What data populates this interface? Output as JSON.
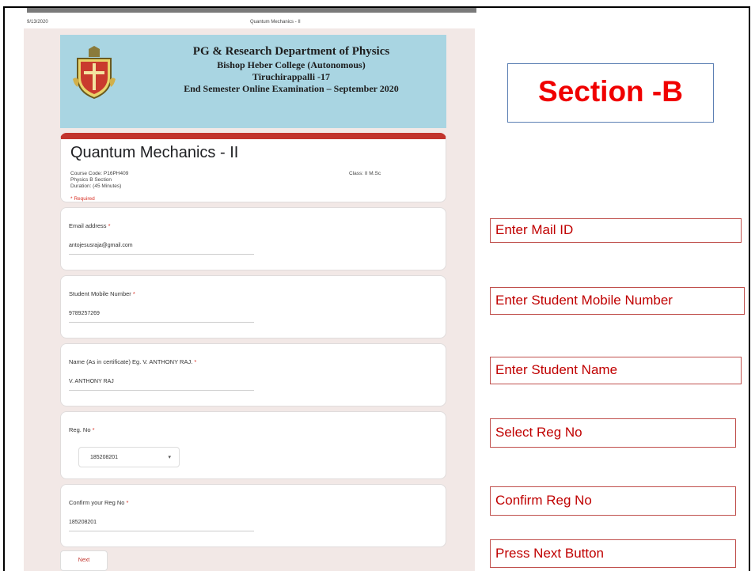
{
  "print_header": {
    "date": "9/13/2020",
    "title": "Quantum Mechanics - II"
  },
  "banner": {
    "line1": "PG & Research Department of Physics",
    "line2": "Bishop Heber College (Autonomous)",
    "line3": "Tiruchirappalli -17",
    "line4": "End Semester Online Examination – September 2020"
  },
  "form": {
    "title": "Quantum Mechanics - II",
    "course_code": "Course Code: P16PH409",
    "section": "Physics B Section",
    "duration": "Duration: (45 Minutes)",
    "class": "Class: II M.Sc",
    "required_note": "* Required"
  },
  "questions": {
    "email": {
      "label": "Email address",
      "star": " *",
      "value": "antojesusraja@gmail.com"
    },
    "mobile": {
      "label": "Student Mobile Number",
      "star": " *",
      "value": "9789257269"
    },
    "name": {
      "label": "Name (As in certificate) Eg. V. ANTHONY RAJ.",
      "star": " *",
      "value": "V. ANTHONY RAJ"
    },
    "reg": {
      "label": "Reg. No",
      "star": " *",
      "value": "185208201",
      "caret": "▾"
    },
    "confirm": {
      "label": "Confirm your Reg No",
      "star": " *",
      "value": "185208201"
    }
  },
  "next_button": "Next",
  "annotations": {
    "section": "Section -B",
    "mail": "Enter Mail ID",
    "mobile": "Enter Student Mobile Number",
    "name": "Enter Student Name",
    "reg": "Select  Reg No",
    "confirm": "Confirm Reg No",
    "next": "Press Next Button"
  },
  "colors": {
    "accent": "#c2342d",
    "banner": "#a9d5e2",
    "annotation_border": "#c0504d",
    "annotation_text": "#c00000",
    "section_text": "#f00000"
  }
}
